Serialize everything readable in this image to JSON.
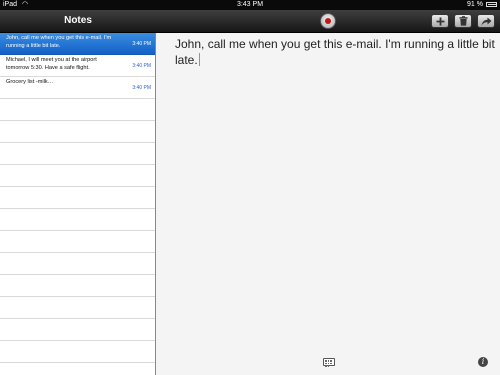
{
  "status_bar": {
    "carrier": "iPad",
    "wifi_icon": "wifi-icon",
    "time": "3:43 PM",
    "battery": "91 %",
    "battery_icon": "battery-icon"
  },
  "sidebar": {
    "title": "Notes",
    "notes": [
      {
        "preview": "John, call me when you get this e-mail. I'm running a little bit late.",
        "time": "3:40 PM",
        "selected": true
      },
      {
        "preview": "Michael, I will meet you at the airport tomorrow 5:30. Have a safe flight.",
        "time": "3:40 PM",
        "selected": false
      },
      {
        "preview": "Grocery list -milk…",
        "time": "3:40 PM",
        "selected": false
      }
    ]
  },
  "toolbar": {
    "record_icon": "record-icon",
    "add_icon": "add-icon",
    "trash_icon": "trash-icon",
    "share_icon": "share-icon"
  },
  "editor": {
    "text": "John, call me when you get this e-mail. I'm running a little bit late.",
    "keyboard_icon": "keyboard-icon",
    "info_icon": "info-icon"
  },
  "colors": {
    "selection": "#1a6fd6",
    "time_blue": "#2a5fd0",
    "record_red": "#c51616",
    "caret_green": "#56c24a"
  }
}
